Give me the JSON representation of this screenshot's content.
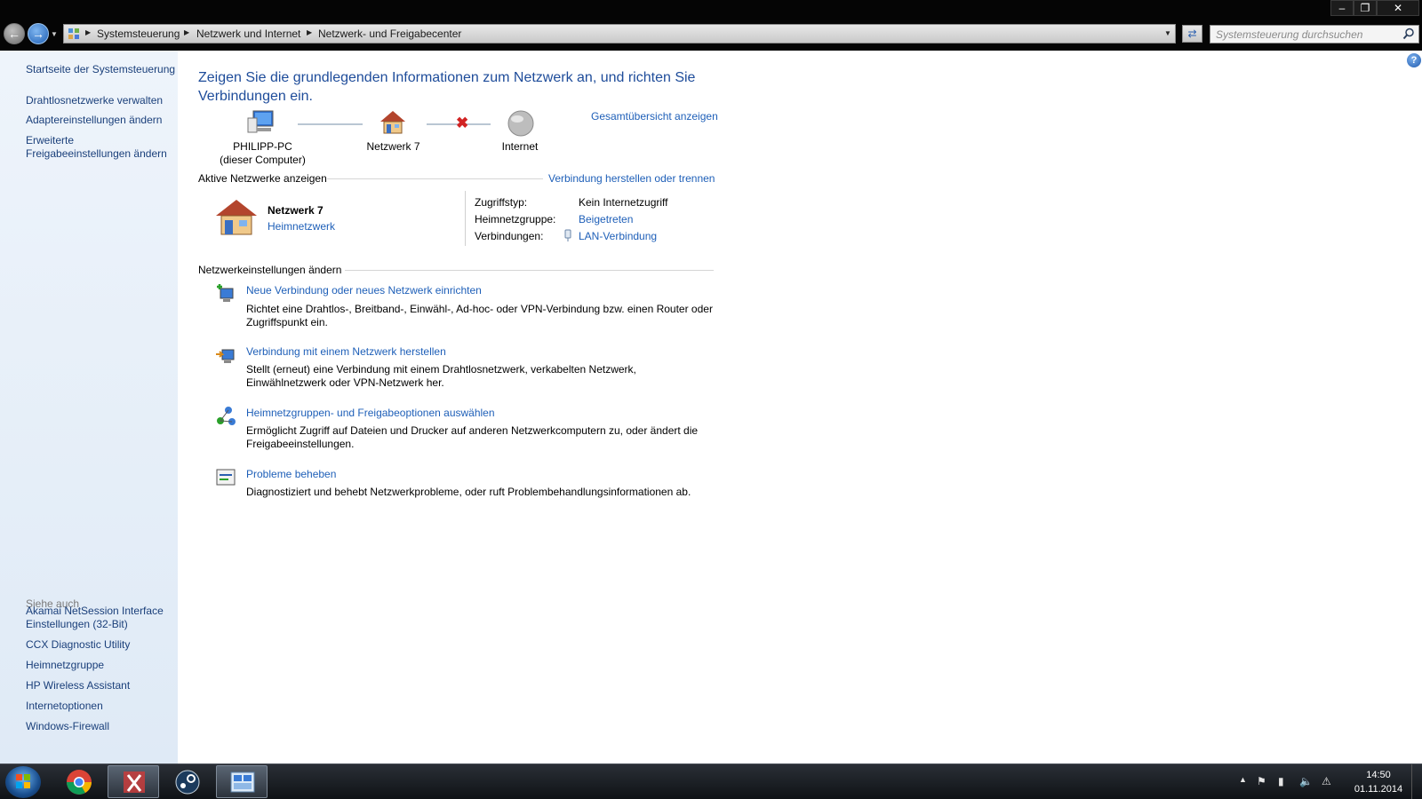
{
  "window": {
    "minimize_label": "–",
    "maximize_label": "❐",
    "close_label": "✕"
  },
  "navbar": {
    "breadcrumbs": [
      "Systemsteuerung",
      "Netzwerk und Internet",
      "Netzwerk- und Freigabecenter"
    ],
    "search_placeholder": "Systemsteuerung durchsuchen"
  },
  "sidebar": {
    "items": [
      {
        "label": "Startseite der Systemsteuerung"
      },
      {
        "label": "Drahtlosnetzwerke verwalten"
      },
      {
        "label": "Adaptereinstellungen ändern"
      },
      {
        "label": "Erweiterte Freigabeeinstellungen ändern"
      }
    ],
    "see_also_title": "Siehe auch",
    "see_also": [
      {
        "label": "Akamai NetSession Interface Einstellungen (32-Bit)"
      },
      {
        "label": "CCX Diagnostic Utility"
      },
      {
        "label": "Heimnetzgruppe"
      },
      {
        "label": "HP Wireless Assistant"
      },
      {
        "label": "Internetoptionen"
      },
      {
        "label": "Windows-Firewall"
      }
    ]
  },
  "main": {
    "title": "Zeigen Sie die grundlegenden Informationen zum Netzwerk an, und richten Sie Verbindungen ein.",
    "map": {
      "computer_name": "PHILIPP-PC",
      "computer_sub": "(dieser Computer)",
      "network_name": "Netzwerk  7",
      "internet_label": "Internet",
      "full_map_link": "Gesamtübersicht anzeigen"
    },
    "active_networks": {
      "title": "Aktive Netzwerke anzeigen",
      "connect_link": "Verbindung herstellen oder trennen",
      "network_name": "Netzwerk  7",
      "network_type": "Heimnetzwerk",
      "access_type_label": "Zugriffstyp:",
      "access_type_value": "Kein Internetzugriff",
      "homegroup_label": "Heimnetzgruppe:",
      "homegroup_value": "Beigetreten",
      "connections_label": "Verbindungen:",
      "connections_value": "LAN-Verbindung"
    },
    "change_settings": {
      "title": "Netzwerkeinstellungen ändern",
      "tasks": [
        {
          "title": "Neue Verbindung oder neues Netzwerk einrichten",
          "desc": "Richtet eine Drahtlos-, Breitband-, Einwähl-, Ad-hoc- oder VPN-Verbindung bzw. einen Router oder Zugriffspunkt ein."
        },
        {
          "title": "Verbindung mit einem Netzwerk herstellen",
          "desc": "Stellt (erneut) eine Verbindung mit einem Drahtlosnetzwerk, verkabelten Netzwerk, Einwählnetzwerk oder VPN-Netzwerk her."
        },
        {
          "title": "Heimnetzgruppen- und Freigabeoptionen auswählen",
          "desc": "Ermöglicht Zugriff auf Dateien und Drucker auf anderen Netzwerkcomputern zu, oder ändert die Freigabeeinstellungen."
        },
        {
          "title": "Probleme beheben",
          "desc": "Diagnostiziert und behebt Netzwerkprobleme, oder ruft Problembehandlungsinformationen ab."
        }
      ]
    }
  },
  "taskbar": {
    "time": "14:50",
    "date": "01.11.2014",
    "pinned": [
      "chrome-icon",
      "snipping-tool-icon",
      "steam-icon",
      "network-center-icon"
    ]
  },
  "colors": {
    "link": "#1e5fb8",
    "title": "#1e4c9a",
    "sidebar_bg": "#e4eef8"
  }
}
